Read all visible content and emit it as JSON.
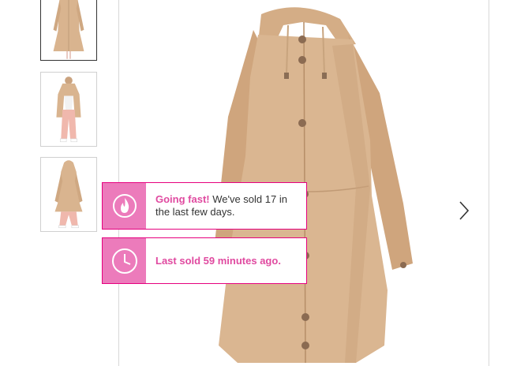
{
  "gallery": {
    "thumbnails": [
      {
        "alt": "coat-front-thumbnail",
        "selected": true
      },
      {
        "alt": "coat-worn-open-thumbnail",
        "selected": false
      },
      {
        "alt": "coat-back-thumbnail",
        "selected": false
      }
    ],
    "main_image": "beige-hooded-parka-coat",
    "prev_arrow_icon": "chevron-left-icon",
    "next_arrow_icon": "chevron-right-icon"
  },
  "notices": {
    "going_fast": {
      "icon": "flame-icon",
      "highlight": "Going fast!",
      "message": " We've sold 17 in the last few days."
    },
    "last_sold": {
      "icon": "clock-icon",
      "message": "Last sold 59 minutes ago."
    }
  },
  "colors": {
    "accent": "#e04aa0",
    "icon_bg": "#ec7bbb",
    "coat": "#d9b48f"
  }
}
